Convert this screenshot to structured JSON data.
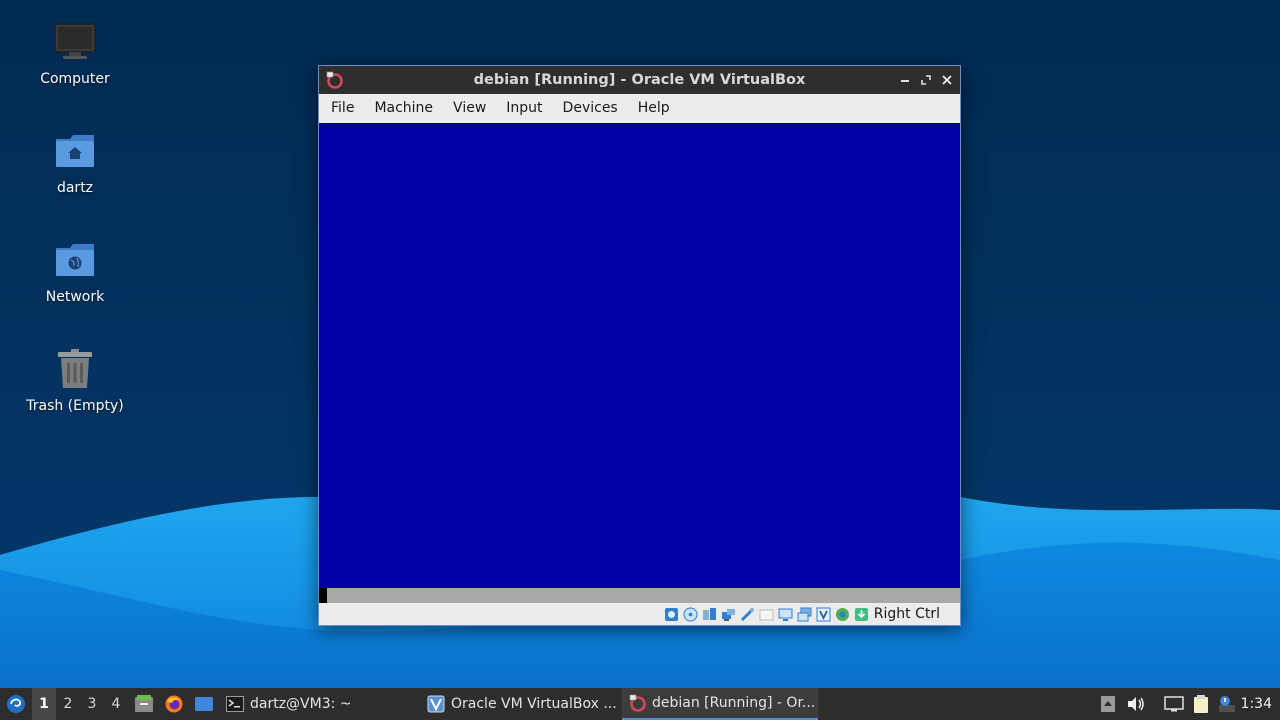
{
  "desktop": {
    "icons": [
      {
        "label": "Computer",
        "icon": "computer-icon"
      },
      {
        "label": "dartz",
        "icon": "home-folder-icon"
      },
      {
        "label": "Network",
        "icon": "network-folder-icon"
      },
      {
        "label": "Trash (Empty)",
        "icon": "trash-icon"
      }
    ]
  },
  "window": {
    "title": "debian [Running] - Oracle VM VirtualBox",
    "menu": [
      "File",
      "Machine",
      "View",
      "Input",
      "Devices",
      "Help"
    ],
    "vm_screen_color": "#0000a4",
    "status": {
      "icons": [
        "hard-disk-icon",
        "optical-drive-icon",
        "audio-icon",
        "network-icon",
        "usb-icon",
        "shared-folders-icon",
        "display-icon",
        "recording-icon",
        "vt-x-icon",
        "guest-additions-icon",
        "mouse-integration-icon"
      ],
      "host_key": "Right Ctrl"
    }
  },
  "taskbar": {
    "workspaces": [
      "1",
      "2",
      "3",
      "4"
    ],
    "active_workspace": "1",
    "tasks": [
      {
        "label": "dartz@VM3: ~",
        "icon": "terminal-icon"
      },
      {
        "label": "Oracle VM VirtualBox ...",
        "icon": "virtualbox-manager-icon"
      },
      {
        "label": "debian [Running] - Or...",
        "icon": "virtualbox-vm-icon",
        "active": true
      }
    ],
    "clock": "1:34"
  }
}
